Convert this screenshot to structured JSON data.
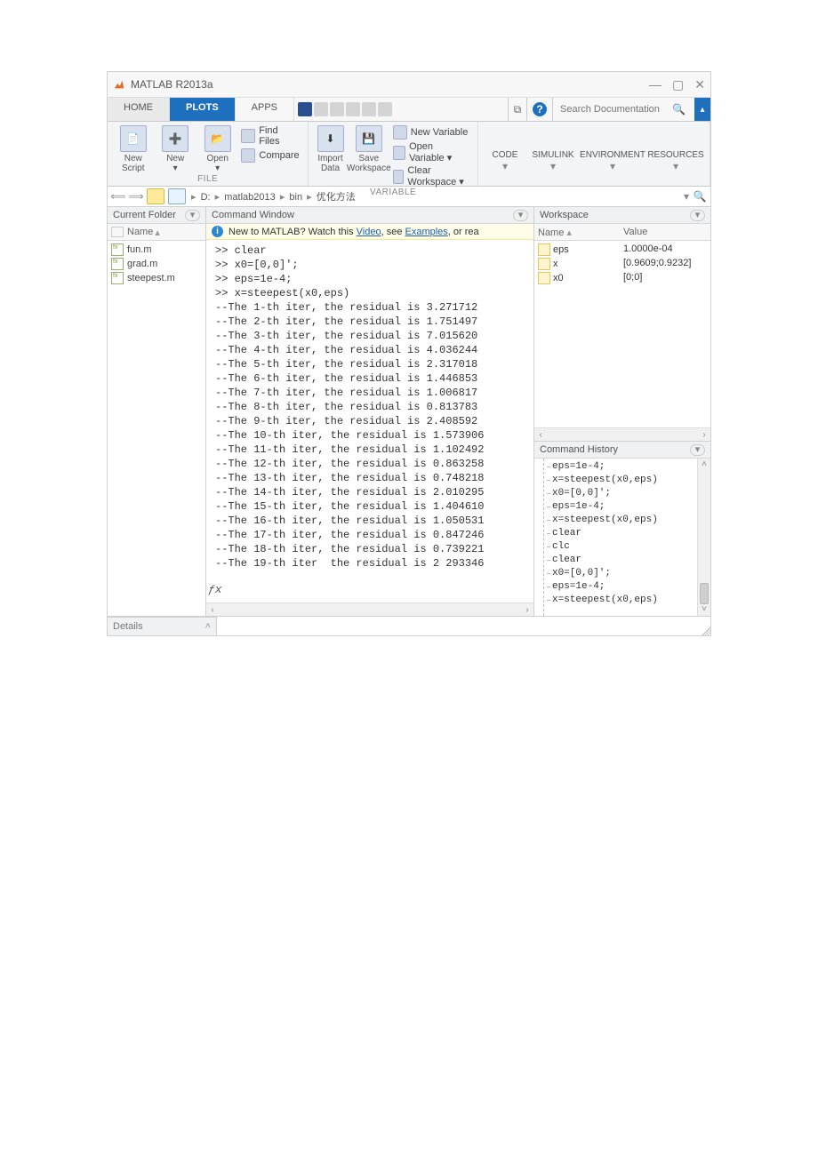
{
  "window": {
    "title": "MATLAB R2013a"
  },
  "tabs": {
    "home": "HOME",
    "plots": "PLOTS",
    "apps": "APPS"
  },
  "search": {
    "placeholder": "Search Documentation"
  },
  "ribbon": {
    "file": {
      "label": "FILE",
      "new_script": "New\nScript",
      "new": "New",
      "open": "Open",
      "find_files": "Find Files",
      "compare": "Compare"
    },
    "variable": {
      "label": "VARIABLE",
      "import": "Import\nData",
      "save_ws": "Save\nWorkspace",
      "new_var": "New Variable",
      "open_var": "Open Variable",
      "clear_ws": "Clear Workspace"
    },
    "code": "CODE",
    "simulink": "SIMULINK",
    "environment": "ENVIRONMENT",
    "resources": "RESOURCES"
  },
  "address": {
    "segments": [
      "D:",
      "matlab2013",
      "bin",
      "优化方法"
    ]
  },
  "panels": {
    "current_folder": {
      "title": "Current Folder",
      "col_name": "Name",
      "files": [
        "fun.m",
        "grad.m",
        "steepest.m"
      ],
      "details": "Details"
    },
    "command_window": {
      "title": "Command Window",
      "banner_pre": "New to MATLAB? Watch this ",
      "banner_link1": "Video",
      "banner_mid": ", see ",
      "banner_link2": "Examples",
      "banner_post": ", or rea",
      "lines": [
        ">> clear",
        ">> x0=[0,0]';",
        ">> eps=1e-4;",
        ">> x=steepest(x0,eps)",
        "--The 1-th iter, the residual is 3.271712",
        "--The 2-th iter, the residual is 1.751497",
        "--The 3-th iter, the residual is 7.015620",
        "--The 4-th iter, the residual is 4.036244",
        "--The 5-th iter, the residual is 2.317018",
        "--The 6-th iter, the residual is 1.446853",
        "--The 7-th iter, the residual is 1.006817",
        "--The 8-th iter, the residual is 0.813783",
        "--The 9-th iter, the residual is 2.408592",
        "--The 10-th iter, the residual is 1.573906",
        "--The 11-th iter, the residual is 1.102492",
        "--The 12-th iter, the residual is 0.863258",
        "--The 13-th iter, the residual is 0.748218",
        "--The 14-th iter, the residual is 2.010295",
        "--The 15-th iter, the residual is 1.404610",
        "--The 16-th iter, the residual is 1.050531",
        "--The 17-th iter, the residual is 0.847246",
        "--The 18-th iter, the residual is 0.739221",
        "--The 19-th iter  the residual is 2 293346"
      ]
    },
    "workspace": {
      "title": "Workspace",
      "col_name": "Name",
      "col_value": "Value",
      "vars": [
        {
          "name": "eps",
          "value": "1.0000e-04"
        },
        {
          "name": "x",
          "value": "[0.9609;0.9232]"
        },
        {
          "name": "x0",
          "value": "[0;0]"
        }
      ]
    },
    "history": {
      "title": "Command History",
      "items": [
        "eps=1e-4;",
        "x=steepest(x0,eps)",
        "x0=[0,0]';",
        "eps=1e-4;",
        "x=steepest(x0,eps)",
        "clear",
        "clc",
        "clear",
        "x0=[0,0]';",
        "eps=1e-4;",
        "x=steepest(x0,eps)"
      ]
    }
  }
}
